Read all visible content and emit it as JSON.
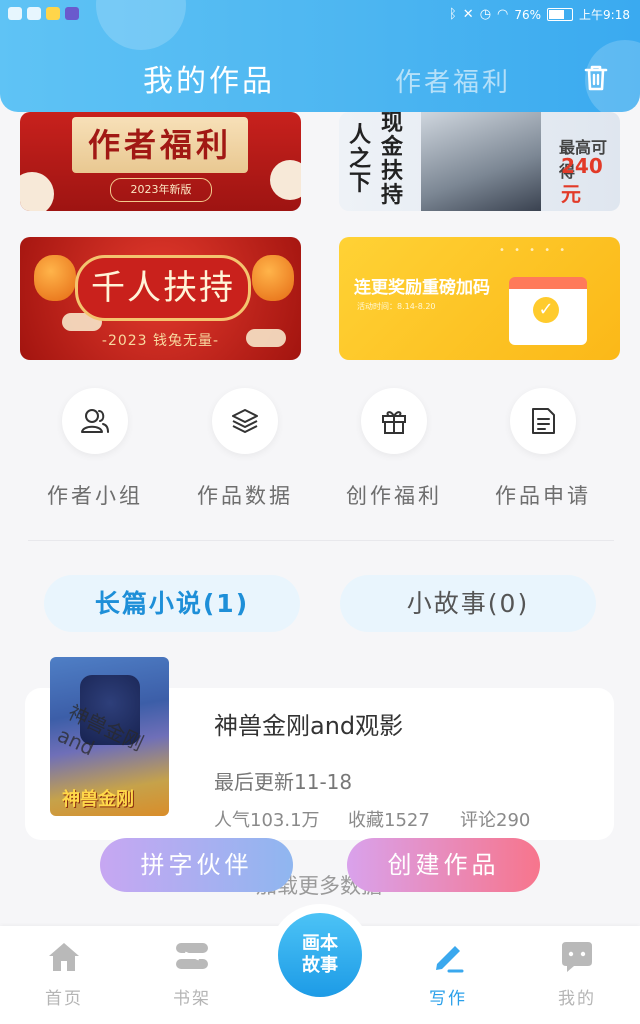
{
  "status_bar": {
    "battery": "76%",
    "time": "上午9:18",
    "battery_level": 0.76
  },
  "header": {
    "tab_works": "我的作品",
    "tab_welfare": "作者福利",
    "trash_icon": "trash-icon"
  },
  "banners": {
    "welfare": {
      "title": "作者福利",
      "subtitle": "2023年新版"
    },
    "support": {
      "vertical_text": [
        "人之下",
        "现金扶持"
      ],
      "price_label": "最高可得",
      "price_value": "240元"
    },
    "thousand": {
      "title": "千人扶持",
      "subtitle": "-2023 钱兔无量-"
    },
    "streak": {
      "title": "连更奖励重磅加码",
      "date": "活动时间：8.14-8.20"
    }
  },
  "actions": [
    {
      "label": "作者小组",
      "icon": "users-icon"
    },
    {
      "label": "作品数据",
      "icon": "layers-icon"
    },
    {
      "label": "创作福利",
      "icon": "gift-icon"
    },
    {
      "label": "作品申请",
      "icon": "document-icon"
    }
  ],
  "categories": {
    "long": "长篇小说(1)",
    "short": "小故事(0)"
  },
  "work": {
    "cover_text": "神兽金刚and",
    "cover_logo": "神兽金刚",
    "title": "神兽金刚and观影",
    "updated": "最后更新11-18",
    "popularity": "人气103.1万",
    "favorites": "收藏1527",
    "comments": "评论290"
  },
  "load_more": "加载更多数据",
  "floating": {
    "partner": "拼字伙伴",
    "create": "创建作品"
  },
  "bottom_nav": {
    "home": "首页",
    "shelf": "书架",
    "center_line1": "画本",
    "center_line2": "故事",
    "write": "写作",
    "mine": "我的"
  },
  "colors": {
    "accent": "#2aa0ea",
    "header": "#4db6f1"
  }
}
